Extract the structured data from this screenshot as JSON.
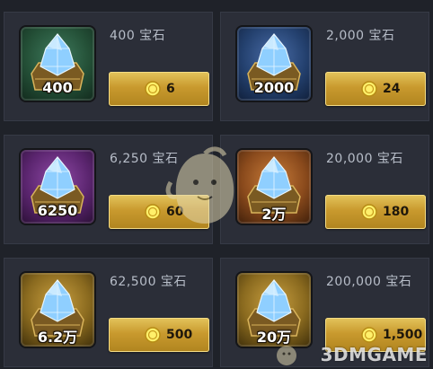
{
  "currency_name": "宝石",
  "packs": [
    {
      "id": "pack-400",
      "gems_label": "400 宝石",
      "thumb_label": "400",
      "price": "6",
      "theme": "green"
    },
    {
      "id": "pack-2000",
      "gems_label": "2,000 宝石",
      "thumb_label": "2000",
      "price": "24",
      "theme": "blue"
    },
    {
      "id": "pack-6250",
      "gems_label": "6,250 宝石",
      "thumb_label": "6250",
      "price": "60",
      "theme": "purple"
    },
    {
      "id": "pack-20000",
      "gems_label": "20,000 宝石",
      "thumb_label": "2万",
      "price": "180",
      "theme": "orange"
    },
    {
      "id": "pack-62500",
      "gems_label": "62,500 宝石",
      "thumb_label": "6.2万",
      "price": "500",
      "theme": "gold"
    },
    {
      "id": "pack-200000",
      "gems_label": "200,000 宝石",
      "thumb_label": "20万",
      "price": "1,500",
      "theme": "gold"
    }
  ],
  "watermark": "3DMGAME",
  "colors": {
    "background": "#1f2229",
    "card": "#2b2e38",
    "button_gold": "#c99a2e",
    "text_muted": "#b7bdc8"
  }
}
